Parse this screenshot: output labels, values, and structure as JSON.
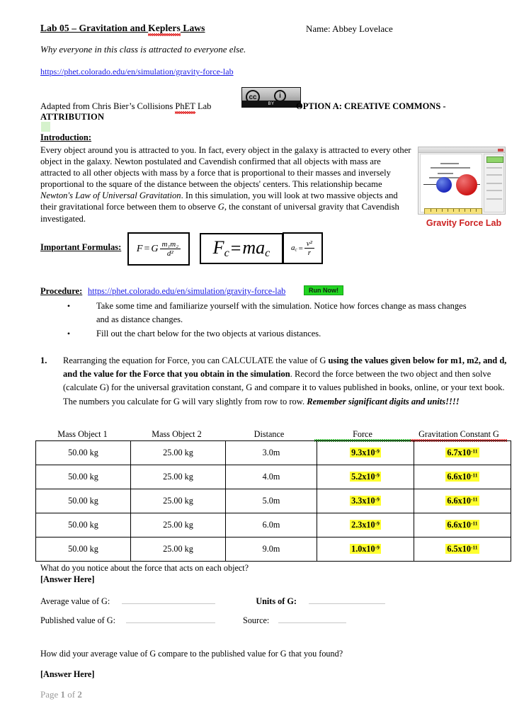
{
  "header": {
    "title_prefix": "Lab 05 – Gravitation and ",
    "title_misspelled": "Keplers",
    "title_suffix": " Laws",
    "name_label": "Name: Abbey Lovelace",
    "subtitle": "Why everyone in this class is attracted to everyone else.",
    "link_url": "https://phet.colorado.edu/en/simulation/gravity-force-lab"
  },
  "attribution": {
    "text_before": "Adapted from Chris Bier’s Collisions ",
    "misspelled": "PhET",
    "text_after": " Lab",
    "cc_badge": {
      "cc_glyph": "cc",
      "by_glyph": "i",
      "by_label": "BY"
    },
    "option_text": "OPTION A: CREATIVE COMMONS -",
    "attribution_word": "ATTRIBUTION"
  },
  "introduction": {
    "heading": "Introduction:",
    "paragraph_part1": "Every object around you is attracted to you.  In fact, every object in the galaxy is attracted to every other object in the galaxy.  Newton postulated and Cavendish confirmed that all objects with mass are attracted to all other objects with mass by a force that is proportional to their masses and inversely proportional to the square of the distance between the objects' centers.  This relationship became ",
    "italic_phrase": "Newton's Law of Universal Gravitation",
    "paragraph_part2": ".  In this simulation, you will look at two massive objects and their gravitational force between them to observe ",
    "italic_g": "G",
    "paragraph_part3": ", the constant of universal gravity that Cavendish investigated."
  },
  "simulation": {
    "caption": "Gravity Force Lab",
    "caption_color": "#cc2222"
  },
  "formulas": {
    "label": "Important Formulas:",
    "f1": {
      "lhs": "F",
      "eq": "=",
      "g": "G",
      "num": "m₁m₂",
      "den": "d²"
    },
    "f2": {
      "text": "F",
      "sub1": "c",
      "eq": "=",
      "rhs": "ma",
      "sub2": "c"
    },
    "f3": {
      "lhs": "a",
      "sub": "c",
      "eq": "=",
      "num": "v²",
      "den": "r"
    }
  },
  "procedure": {
    "label": "Procedure:",
    "link_url": "https://phet.colorado.edu/en/simulation/gravity-force-lab",
    "run_button_label": "Run Now!",
    "bullets": [
      "Take some time and familiarize yourself with the simulation.  Notice how forces change as mass changes and as distance changes.",
      "Fill out the chart below for the two objects at various distances."
    ]
  },
  "item1": {
    "number": "1.",
    "part1": "Rearranging the equation for Force, you can CALCULATE the value of G ",
    "bold1": "using the values given below for m1, m2, and d, and the value for the Force that you obtain in the simulation",
    "part2": ".  Record the force between the two object and then solve (calculate G) for the universal gravitation constant, G and compare it to values published in books, online, or your text book.  The numbers you calculate for G will vary slightly from row to row.   ",
    "bold_italic": "Remember significant digits and units!!!!"
  },
  "table": {
    "headers": [
      "Mass Object 1",
      "Mass Object 2",
      "Distance",
      "Force",
      "Gravitation Constant G"
    ],
    "rows": [
      {
        "mass1": "50.00 kg",
        "mass2": "25.00 kg",
        "distance": "3.0m",
        "force_mantissa": "9.3x10",
        "force_exp": "-9",
        "g_mantissa": "6.7x10",
        "g_exp": "-11"
      },
      {
        "mass1": "50.00 kg",
        "mass2": "25.00 kg",
        "distance": "4.0m",
        "force_mantissa": "5.2x10",
        "force_exp": "-9",
        "g_mantissa": "6.6x10",
        "g_exp": "-11"
      },
      {
        "mass1": "50.00 kg",
        "mass2": "25.00 kg",
        "distance": "5.0m",
        "force_mantissa": "3.3x10",
        "force_exp": "-9",
        "g_mantissa": "6.6x10",
        "g_exp": "-11"
      },
      {
        "mass1": "50.00 kg",
        "mass2": "25.00 kg",
        "distance": "6.0m",
        "force_mantissa": "2.3x10",
        "force_exp": "-9",
        "g_mantissa": "6.6x10",
        "g_exp": "-11"
      },
      {
        "mass1": "50.00 kg",
        "mass2": "25.00 kg",
        "distance": "9.0m",
        "force_mantissa": "1.0x10",
        "force_exp": "-9",
        "g_mantissa": "6.5x10",
        "g_exp": "-11"
      }
    ],
    "highlight_color": "#ffff2e"
  },
  "questions": {
    "q_force": "What do you notice about the force that acts on each object?",
    "answer_1": "[Answer Here]",
    "avg_label": "Average value of G:",
    "units_label": "Units of G:",
    "published_label": "Published value of G:",
    "source_label": "Source:",
    "avg_value": "",
    "units_value": "",
    "published_value": "",
    "source_value": "",
    "q_compare": "How did your average value of G compare to the published value for G that you found?",
    "answer_2": "[Answer Here]"
  },
  "footer": {
    "prefix": "Page ",
    "current": "1",
    "middle": " of ",
    "total": "2"
  }
}
